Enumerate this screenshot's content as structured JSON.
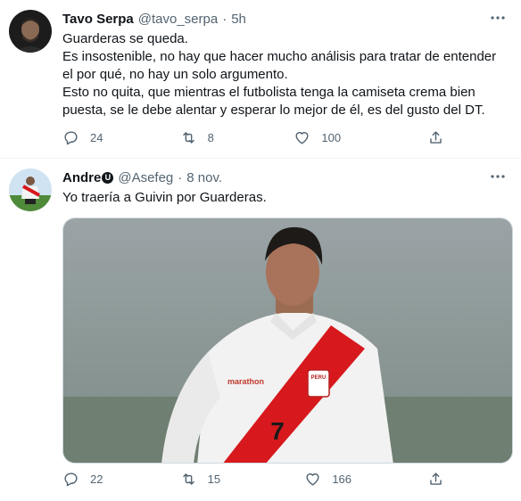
{
  "tweets": [
    {
      "name": "Tavo Serpa",
      "handle": "@tavo_serpa",
      "separator": "·",
      "time": "5h",
      "lines": [
        "Guarderas se queda.",
        "Es insostenible, no hay que hacer mucho análisis para tratar de entender el por qué, no hay un solo argumento.",
        "Esto no quita, que mientras el futbolista tenga la camiseta crema bien puesta, se le debe alentar y esperar lo mejor de él, es del gusto del DT."
      ],
      "replies": "24",
      "retweets": "8",
      "likes": "100"
    },
    {
      "name": "Andre",
      "badge": "U",
      "handle": "@Asefeg",
      "separator": "·",
      "time": "8 nov.",
      "lines": [
        "Yo traería a Guivin por Guarderas."
      ],
      "replies": "22",
      "retweets": "15",
      "likes": "166",
      "media": {
        "jersey_sponsor": "marathon",
        "crest_text": "PERU",
        "number": "7"
      }
    }
  ],
  "icons": [
    "more-icon",
    "reply-icon",
    "retweet-icon",
    "like-icon",
    "share-icon"
  ],
  "colors": {
    "text": "#0f1419",
    "secondary": "#536471",
    "divider": "#eff3f4",
    "sash": "#d7191d"
  }
}
